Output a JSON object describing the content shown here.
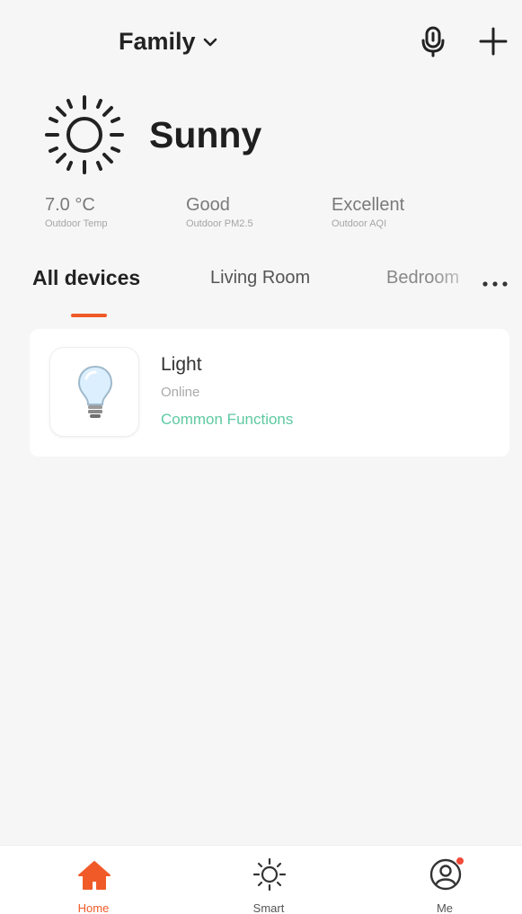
{
  "header": {
    "home_name": "Family",
    "icons": {
      "dropdown": "chevron-down-icon",
      "voice": "microphone-icon",
      "add": "plus-icon"
    }
  },
  "weather": {
    "condition": "Sunny",
    "icon": "sun-icon",
    "metrics": [
      {
        "value": "7.0 °C",
        "label": "Outdoor Temp"
      },
      {
        "value": "Good",
        "label": "Outdoor PM2.5"
      },
      {
        "value": "Excellent",
        "label": "Outdoor AQI"
      }
    ]
  },
  "tabs": {
    "items": [
      "All devices",
      "Living Room",
      "Bedroom"
    ],
    "active_index": 0,
    "more_icon": "more-horizontal-icon",
    "accent_color": "#f05a28"
  },
  "devices": [
    {
      "name": "Light",
      "status": "Online",
      "action": "Common Functions",
      "icon": "light-bulb-icon",
      "action_color": "#5ec9a2"
    }
  ],
  "bottom_nav": {
    "items": [
      {
        "label": "Home",
        "icon": "home-icon",
        "active": true
      },
      {
        "label": "Smart",
        "icon": "sun-outline-icon",
        "active": false
      },
      {
        "label": "Me",
        "icon": "profile-icon",
        "active": false,
        "badge": true
      }
    ],
    "active_color": "#f05a28"
  }
}
